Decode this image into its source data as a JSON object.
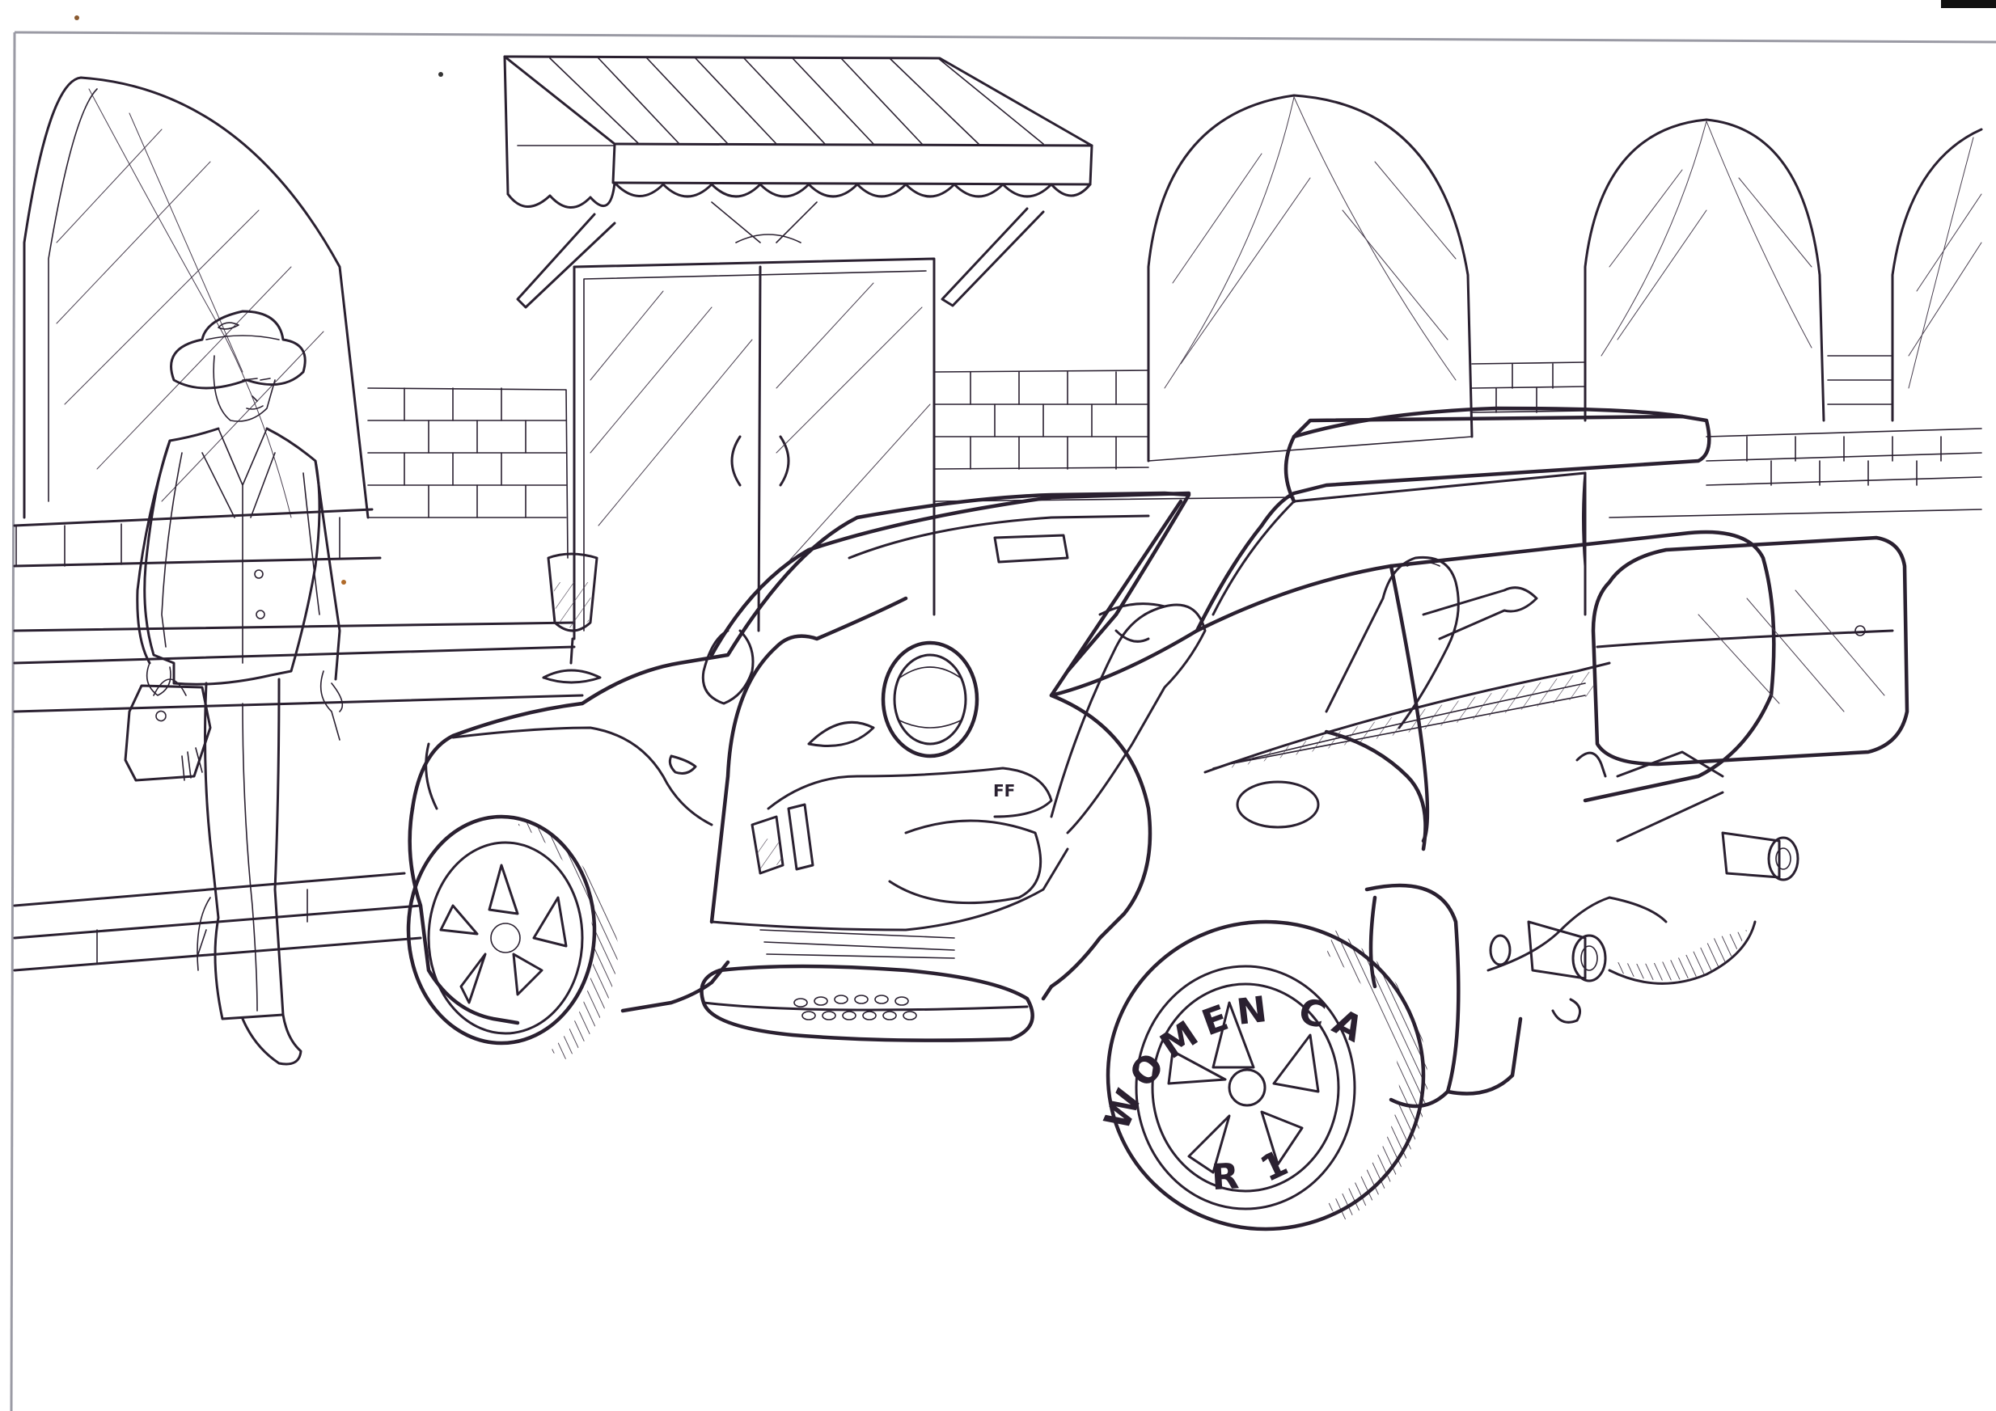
{
  "tire_text": {
    "top": "WOMEN CAR",
    "bottom": "R 17"
  },
  "dashboard_badge": "FF",
  "colors": {
    "ink": "#2a2030",
    "paper": "#ffffff"
  }
}
